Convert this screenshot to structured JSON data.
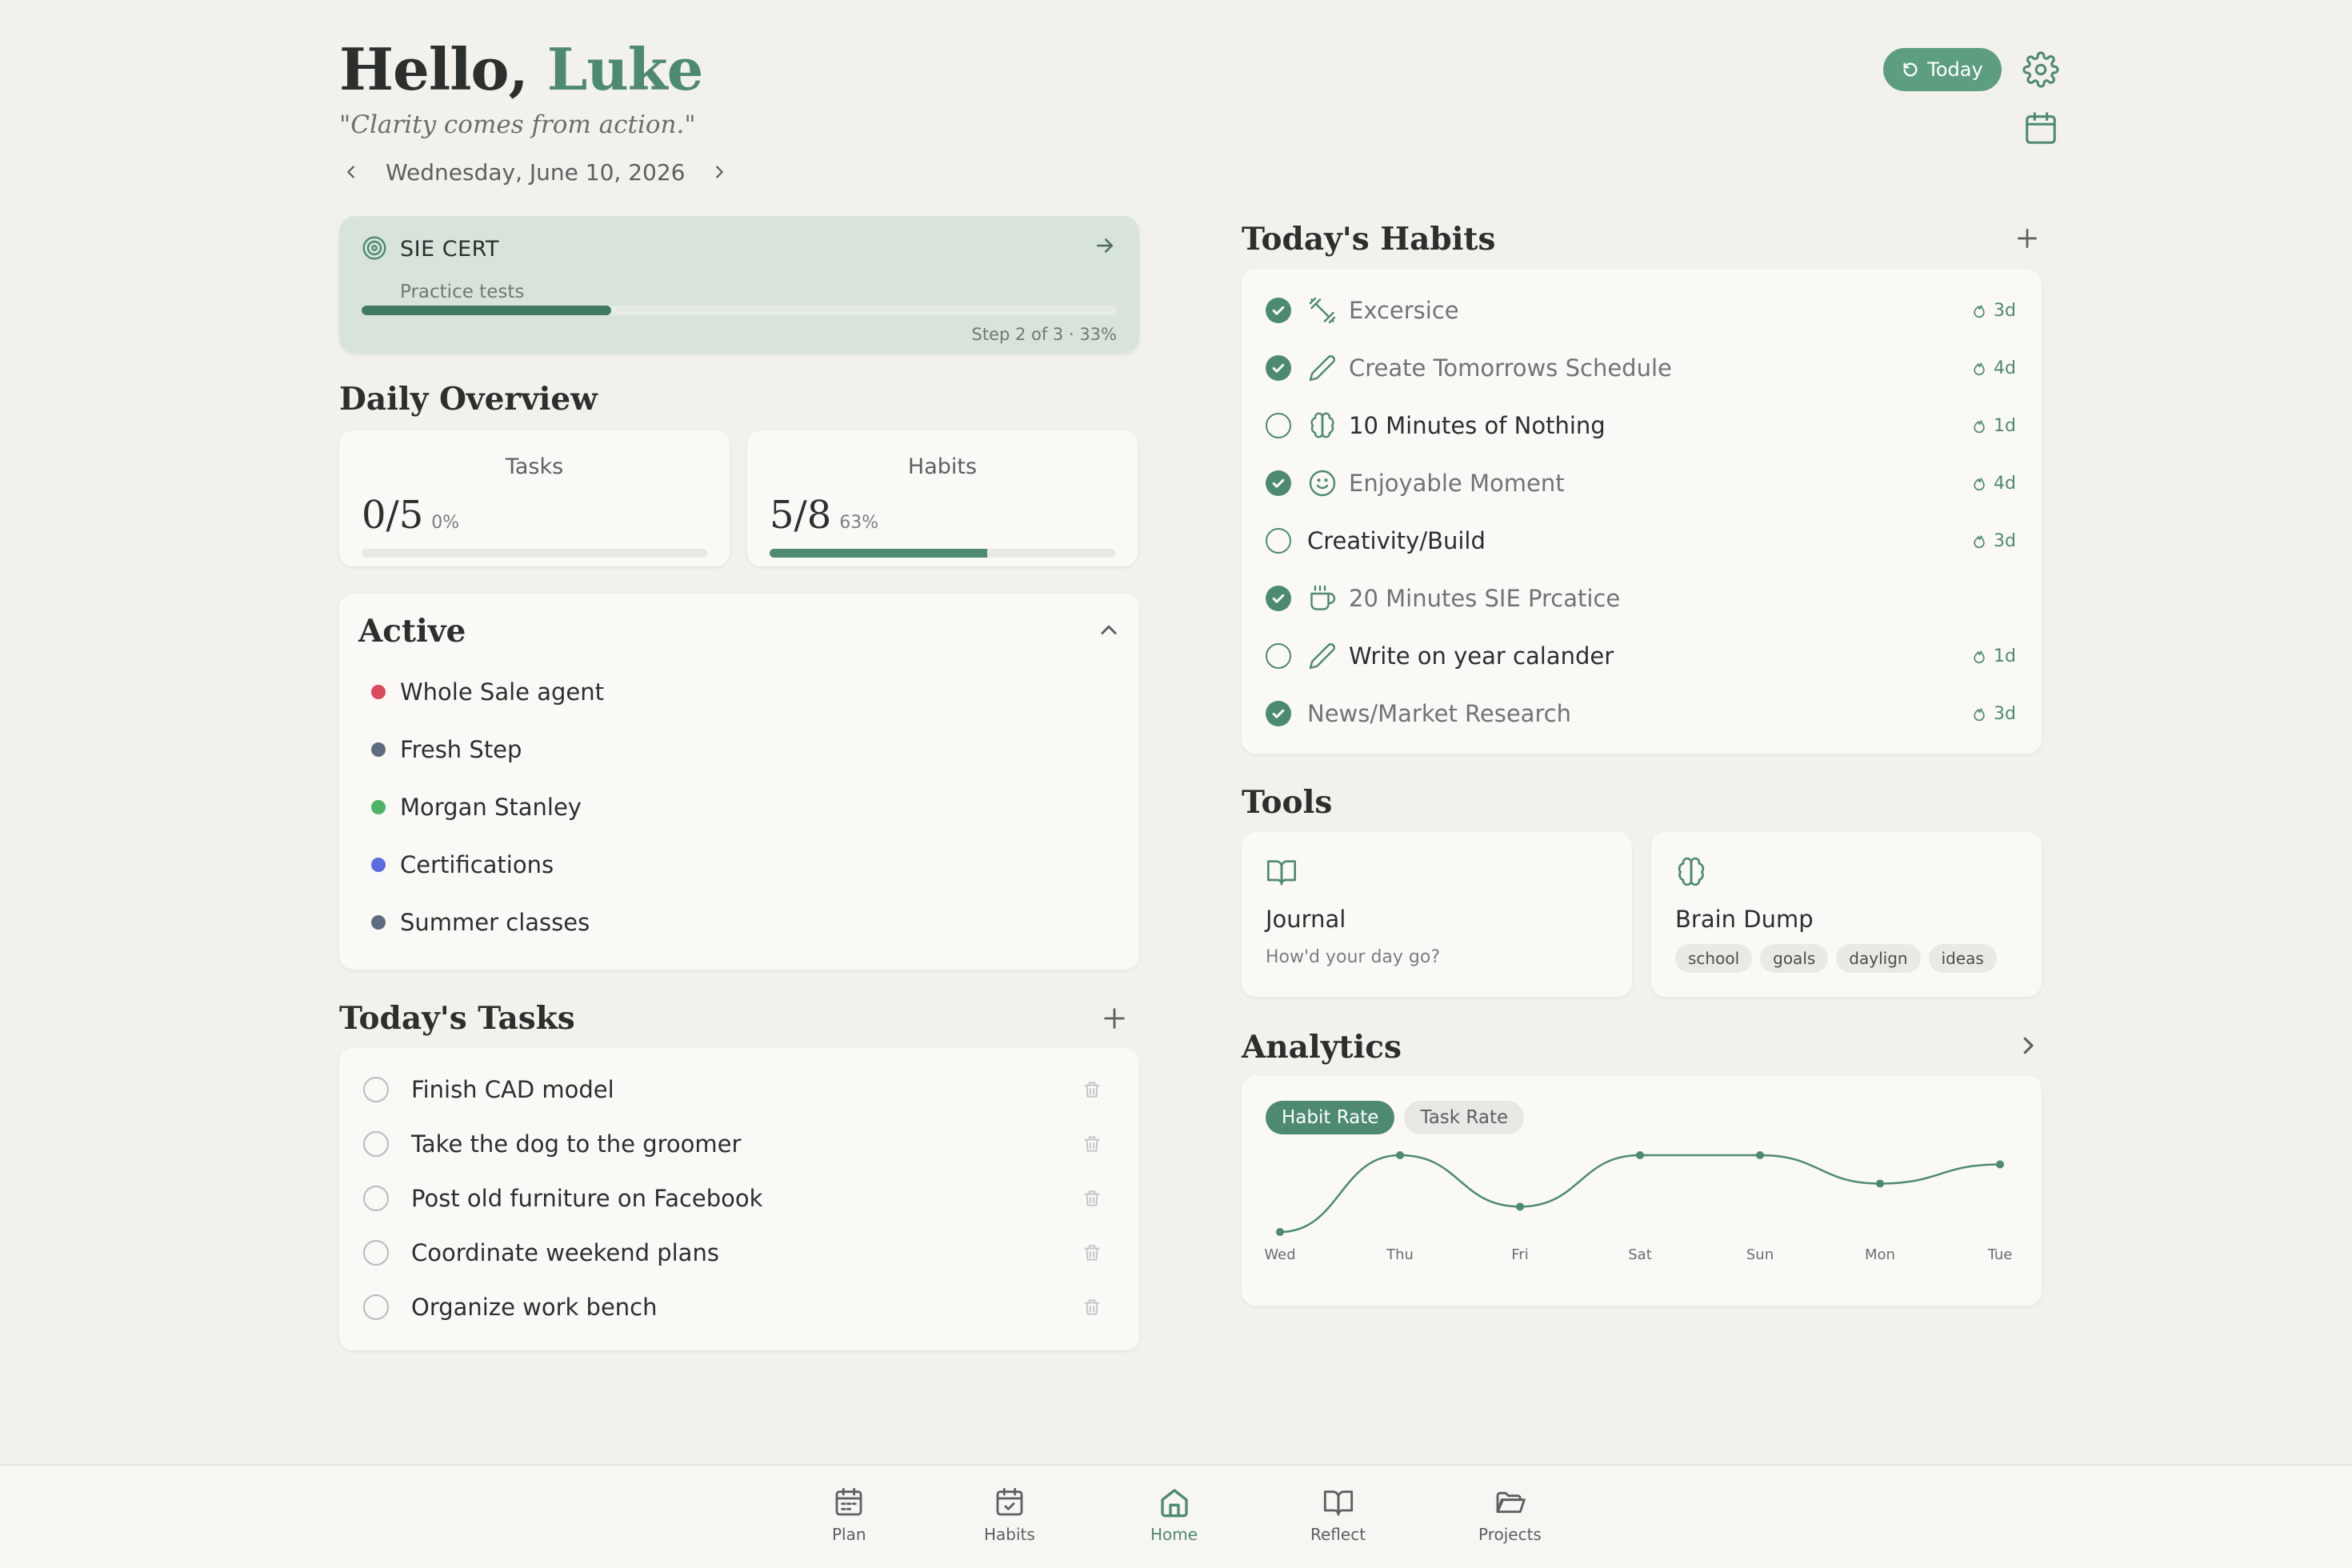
{
  "header": {
    "greeting": "Hello,",
    "name": "Luke",
    "quote": "\"Clarity comes from action.\"",
    "date": "Wednesday, June 10, 2026",
    "today_label": "Today"
  },
  "goal": {
    "title": "SIE CERT",
    "subtitle": "Practice tests",
    "progress": 0.33,
    "step_text": "Step 2 of 3 · 33%"
  },
  "overview": {
    "title": "Daily Overview",
    "tasks": {
      "label": "Tasks",
      "value": "0/5",
      "pct": "0%",
      "progress": 0
    },
    "habits": {
      "label": "Habits",
      "value": "5/8",
      "pct": "63%",
      "progress": 0.63
    }
  },
  "active": {
    "title": "Active",
    "items": [
      {
        "label": "Whole Sale agent",
        "color": "#d94a5a"
      },
      {
        "label": "Fresh Step",
        "color": "#5f6b7e"
      },
      {
        "label": "Morgan Stanley",
        "color": "#4cb464"
      },
      {
        "label": "Certifications",
        "color": "#5b6be0"
      },
      {
        "label": "Summer classes",
        "color": "#5f6b7e"
      }
    ]
  },
  "tasks": {
    "title": "Today's Tasks",
    "items": [
      {
        "label": "Finish CAD model"
      },
      {
        "label": "Take the dog to the groomer"
      },
      {
        "label": "Post old furniture on Facebook"
      },
      {
        "label": "Coordinate weekend plans"
      },
      {
        "label": "Organize work bench"
      }
    ]
  },
  "habits": {
    "title": "Today's Habits",
    "items": [
      {
        "label": "Excersice",
        "done": true,
        "icon": "dumbbell-icon",
        "streak": "3d"
      },
      {
        "label": "Create Tomorrows Schedule",
        "done": true,
        "icon": "pencil-icon",
        "streak": "4d"
      },
      {
        "label": "10 Minutes of Nothing",
        "done": false,
        "icon": "brain-icon",
        "streak": "1d"
      },
      {
        "label": "Enjoyable Moment",
        "done": true,
        "icon": "smile-icon",
        "streak": "4d"
      },
      {
        "label": "Creativity/Build",
        "done": false,
        "icon": "",
        "streak": "3d"
      },
      {
        "label": "20 Minutes SIE Prcatice",
        "done": true,
        "icon": "coffee-icon",
        "streak": ""
      },
      {
        "label": "Write on year calander",
        "done": false,
        "icon": "pencil-icon",
        "streak": "1d"
      },
      {
        "label": "News/Market Research",
        "done": true,
        "icon": "",
        "streak": "3d"
      }
    ]
  },
  "tools": {
    "title": "Tools",
    "journal": {
      "title": "Journal",
      "subtitle": "How'd your day go?"
    },
    "brain_dump": {
      "title": "Brain Dump",
      "tags": [
        "school",
        "goals",
        "daylign",
        "ideas"
      ]
    }
  },
  "analytics": {
    "title": "Analytics",
    "tabs": [
      "Habit Rate",
      "Task Rate"
    ],
    "active_tab": "Habit Rate"
  },
  "chart_data": {
    "type": "line",
    "categories": [
      "Wed",
      "Thu",
      "Fri",
      "Sat",
      "Sun",
      "Mon",
      "Tue"
    ],
    "values": [
      0,
      100,
      33,
      100,
      100,
      63,
      88
    ],
    "ylim": [
      0,
      100
    ],
    "grid": false,
    "color": "#4e8a70"
  },
  "bottom_nav": {
    "items": [
      {
        "label": "Plan",
        "icon": "calendar-icon"
      },
      {
        "label": "Habits",
        "icon": "calendar-check-icon"
      },
      {
        "label": "Home",
        "icon": "home-icon"
      },
      {
        "label": "Reflect",
        "icon": "book-icon"
      },
      {
        "label": "Projects",
        "icon": "folder-icon"
      }
    ],
    "active": "Home"
  },
  "colors": {
    "accent": "#4e8a70",
    "background": "#f3f1ec"
  }
}
